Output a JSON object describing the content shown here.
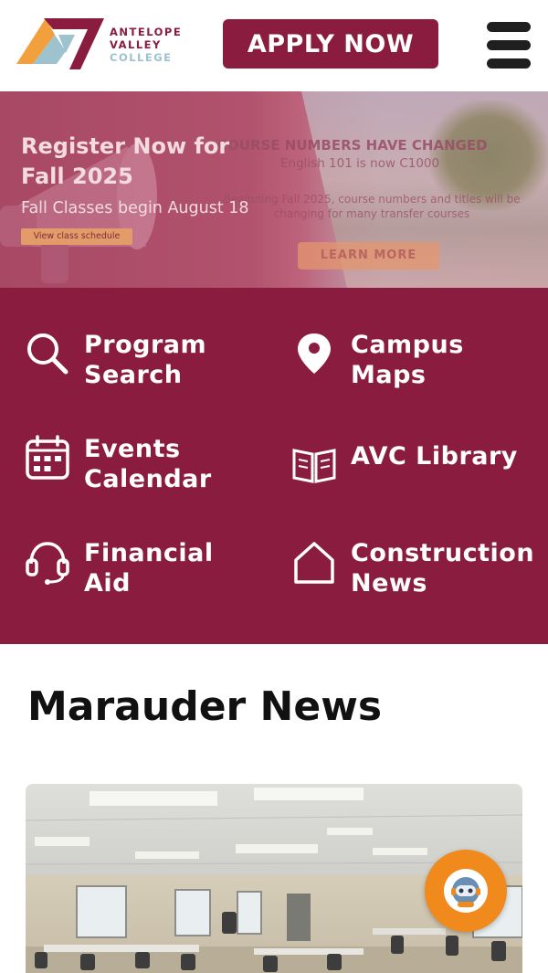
{
  "header": {
    "logo": {
      "line1": "ANTELOPE",
      "line2": "VALLEY",
      "line3": "COLLEGE"
    },
    "apply_label": "APPLY NOW",
    "menu_icon": "hamburger-icon"
  },
  "hero": {
    "slide1": {
      "title_line1": "Register Now for",
      "title_line2": "Fall 2025",
      "subtitle": "Fall Classes begin August 18",
      "chip": "View class schedule"
    },
    "slide2": {
      "title": "COURSE NUMBERS HAVE CHANGED",
      "subtitle": "English 101 is now C1000",
      "body": "Beginning Fall 2025, course numbers and titles will be changing for many transfer courses",
      "button": "LEARN MORE"
    },
    "pause_icon": "pause-icon"
  },
  "quick_links": [
    {
      "label": "Program\nSearch",
      "icon": "search-icon"
    },
    {
      "label": "Campus\nMaps",
      "icon": "map-pin-icon"
    },
    {
      "label": "Events\nCalendar",
      "icon": "calendar-icon"
    },
    {
      "label": "AVC Library",
      "icon": "book-icon"
    },
    {
      "label": "Financial\nAid",
      "icon": "headset-icon"
    },
    {
      "label": "Construction\nNews",
      "icon": "house-icon"
    }
  ],
  "news": {
    "title": "Marauder News"
  },
  "chat": {
    "icon": "chatbot-icon"
  },
  "colors": {
    "brand": "#8a1c3f",
    "accent_orange": "#f08a1c",
    "logo_blue": "#9ec3cf"
  }
}
